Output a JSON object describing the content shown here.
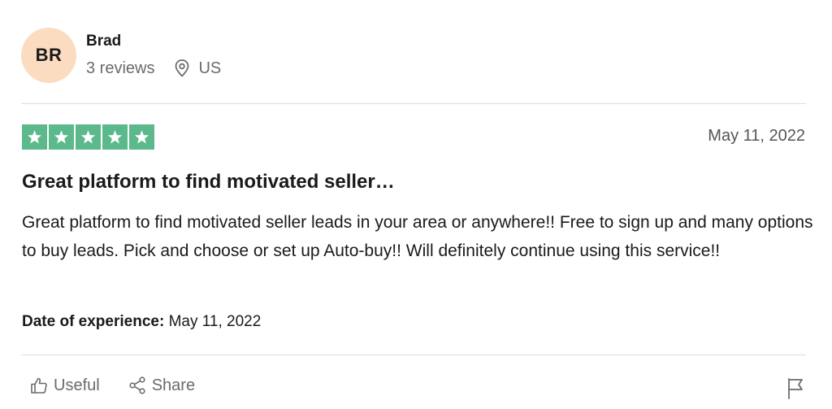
{
  "reviewer": {
    "initials": "BR",
    "name": "Brad",
    "reviews_count": "3 reviews",
    "location": "US",
    "avatar_color": "#fcdcc0"
  },
  "review": {
    "rating": 5,
    "max_rating": 5,
    "star_color": "#5bb98b",
    "date": "May 11, 2022",
    "title": "Great platform to find motivated seller…",
    "body": "Great platform to find motivated seller leads in your area or anywhere!! Free to sign up and many options to buy leads. Pick and choose or set up Auto-buy!! Will definitely continue using this service!!",
    "experience_label": "Date of experience:",
    "experience_date": " May 11, 2022"
  },
  "actions": {
    "useful_label": "Useful",
    "share_label": "Share",
    "useful_icon": "thumbs-up-icon",
    "share_icon": "share-icon",
    "flag_icon": "flag-icon"
  }
}
